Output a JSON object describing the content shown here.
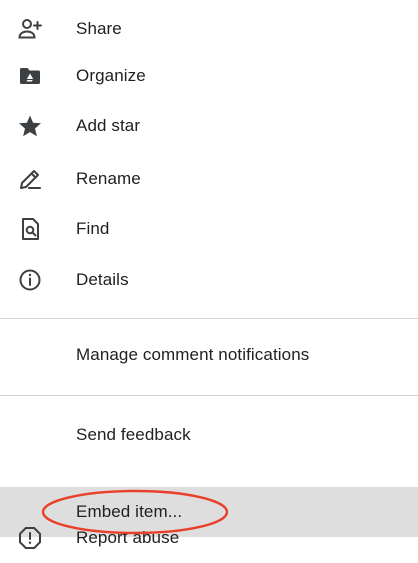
{
  "menu": {
    "items": [
      {
        "label": "Share",
        "icon": "add-person-icon"
      },
      {
        "label": "Organize",
        "icon": "drive-folder-icon"
      },
      {
        "label": "Add star",
        "icon": "star-icon"
      },
      {
        "label": "Rename",
        "icon": "pencil-icon"
      },
      {
        "label": "Find",
        "icon": "find-in-page-icon"
      },
      {
        "label": "Details",
        "icon": "info-icon"
      }
    ],
    "manage_label": "Manage comment notifications",
    "feedback_label": "Send feedback",
    "embed_label": "Embed item...",
    "report_label": "Report abuse",
    "report_icon": "report-icon"
  },
  "colors": {
    "icon": "#3c4043",
    "text": "#202124",
    "highlight": "#dedede",
    "annotation": "#e8402a"
  }
}
